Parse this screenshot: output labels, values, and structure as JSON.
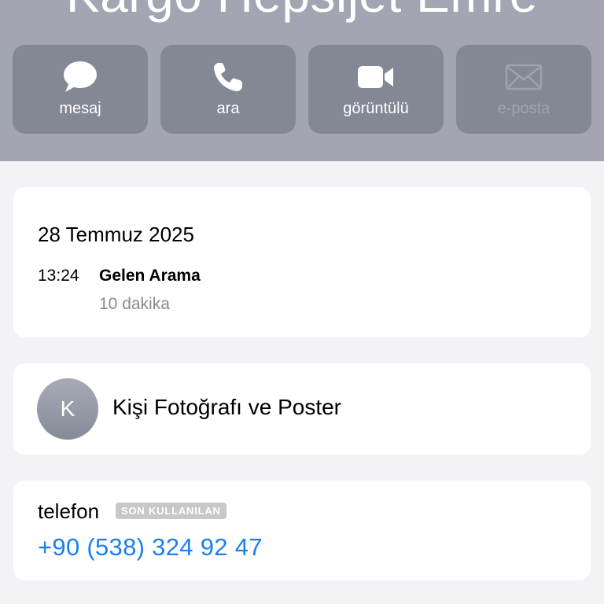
{
  "contact": {
    "name": "Kargo Hepsijet Emre"
  },
  "actions": [
    {
      "label": "mesaj",
      "icon": "message-bubble-icon",
      "enabled": true
    },
    {
      "label": "ara",
      "icon": "phone-icon",
      "enabled": true
    },
    {
      "label": "görüntülü",
      "icon": "video-camera-icon",
      "enabled": true
    },
    {
      "label": "e-posta",
      "icon": "envelope-icon",
      "enabled": false
    }
  ],
  "history": {
    "date": "28 Temmuz 2025",
    "time": "13:24",
    "type": "Gelen Arama",
    "duration": "10 dakika"
  },
  "photo": {
    "initial": "K",
    "label": "Kişi Fotoğrafı ve Poster"
  },
  "phone": {
    "label": "telefon",
    "badge": "SON KULLANILAN",
    "number": "+90 (538) 324 92 47"
  },
  "colors": {
    "header_bg": "#a3a5b2",
    "button_bg": "#848895",
    "link_blue": "#1a80f0",
    "page_bg": "#f2f2f7"
  }
}
